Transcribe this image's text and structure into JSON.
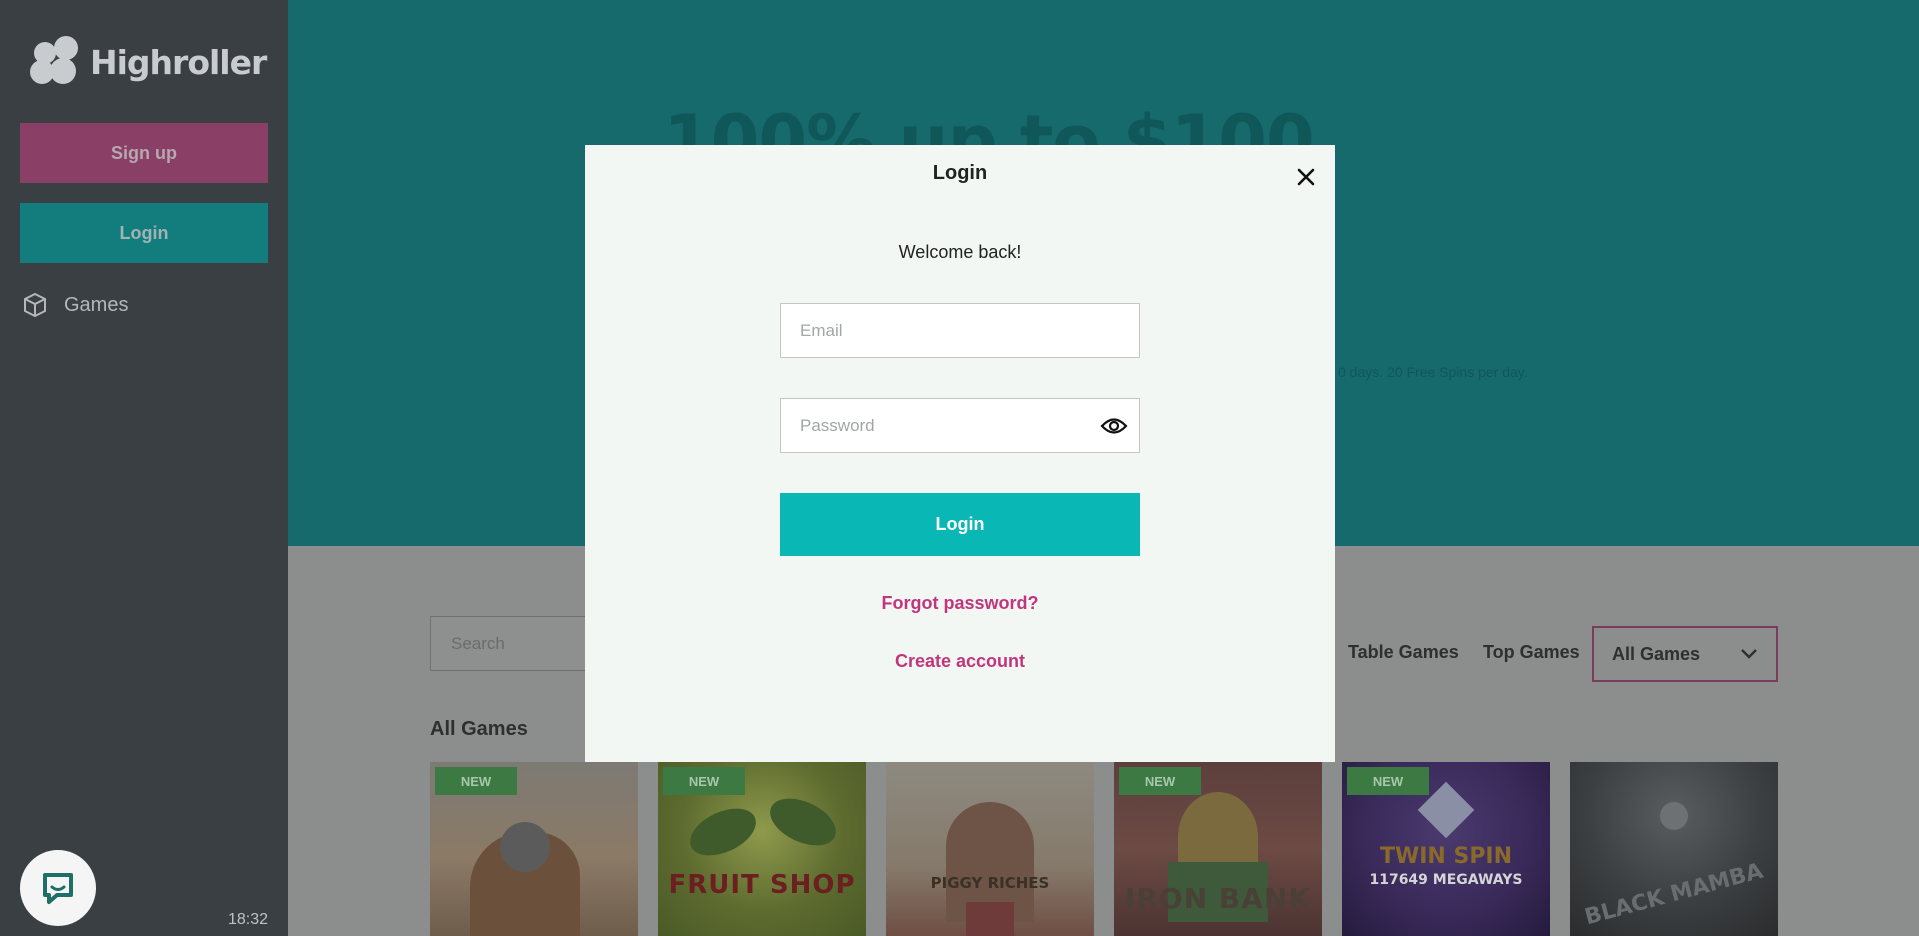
{
  "brand": {
    "name": "Highroller"
  },
  "sidebar": {
    "signup_label": "Sign up",
    "login_label": "Login",
    "nav": [
      {
        "label": "Games",
        "icon": "cube-icon"
      }
    ],
    "chat_icon": "chat-bubble-icon",
    "clock": "18:32"
  },
  "hero": {
    "title": "100% up to $100",
    "subtitle": "0 days. 20 Free Spins per day."
  },
  "games": {
    "search_placeholder": "Search",
    "categories": [
      "Table Games",
      "Top Games"
    ],
    "filter_selected": "All Games",
    "section_title": "All Games",
    "new_badge": "NEW",
    "tiles": [
      {
        "title": "",
        "is_new": true
      },
      {
        "title": "FRUIT SHOP",
        "is_new": true
      },
      {
        "title": "PIGGY RICHES",
        "is_new": false
      },
      {
        "title": "IRON BANK",
        "is_new": true
      },
      {
        "title": "TWIN SPIN",
        "subtitle": "117649 MEGAWAYS",
        "is_new": true
      },
      {
        "title": "BLACK MAMBA",
        "is_new": false
      }
    ]
  },
  "login_modal": {
    "title": "Login",
    "welcome": "Welcome back!",
    "email_placeholder": "Email",
    "password_placeholder": "Password",
    "submit_label": "Login",
    "forgot_label": "Forgot password?",
    "create_label": "Create account"
  },
  "colors": {
    "accent": "#09b7b5",
    "link": "#c2357d",
    "sidebar": "#3a3f43"
  }
}
